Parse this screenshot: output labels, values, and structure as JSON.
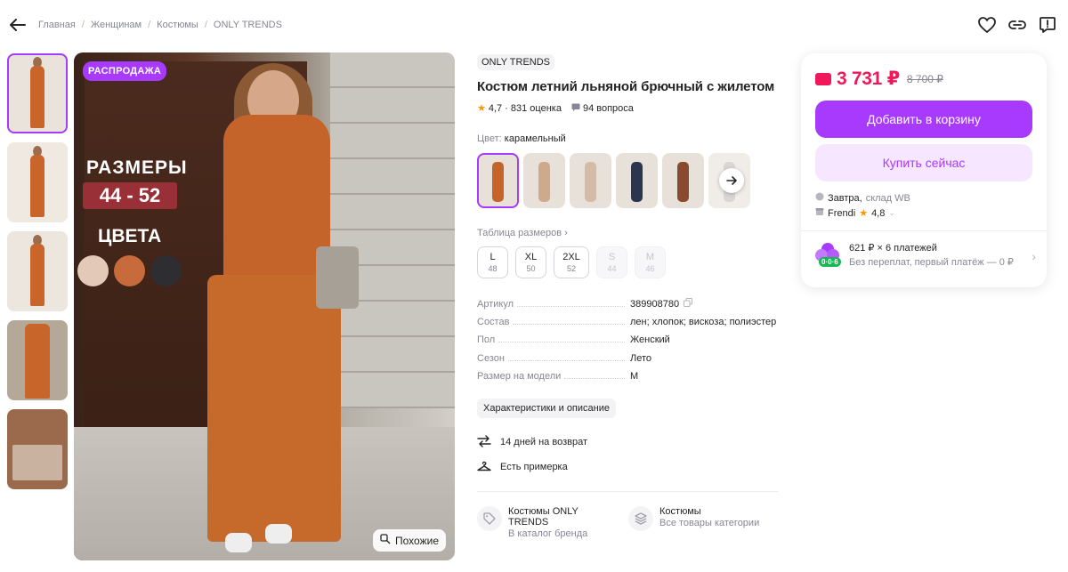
{
  "breadcrumbs": [
    "Главная",
    "Женщинам",
    "Костюмы",
    "ONLY TRENDS"
  ],
  "gallery": {
    "sale_badge": "РАСПРОДАЖА",
    "promo_sizes_title": "РАЗМЕРЫ",
    "promo_size_range": "44 - 52",
    "promo_colors_title": "ЦВЕТА",
    "promo_swatch_colors": [
      "#e2c9b8",
      "#c86b3c",
      "#2e2e32"
    ],
    "similar_label": "Похожие"
  },
  "product": {
    "brand": "ONLY TRENDS",
    "title": "Костюм летний льняной брючный с жилетом",
    "rating": "4,7",
    "rating_count": "· 831 оценка",
    "questions": "94 вопроса",
    "color_label": "Цвет:",
    "color_value": "карамельный",
    "variant_colors": [
      "#c4642a",
      "#cfa98c",
      "#d4bba6",
      "#2c3550",
      "#8a4a2d",
      "#c0bcb8"
    ],
    "size_table_label": "Таблица размеров",
    "sizes": [
      {
        "label": "L",
        "ru": "48",
        "available": true
      },
      {
        "label": "XL",
        "ru": "50",
        "available": true
      },
      {
        "label": "2XL",
        "ru": "52",
        "available": true
      },
      {
        "label": "S",
        "ru": "44",
        "available": false
      },
      {
        "label": "M",
        "ru": "46",
        "available": false
      }
    ],
    "specs": [
      {
        "key": "Артикул",
        "value": "389908780"
      },
      {
        "key": "Состав",
        "value": "лен; хлопок; вискоза; полиэстер"
      },
      {
        "key": "Пол",
        "value": "Женский"
      },
      {
        "key": "Сезон",
        "value": "Лето"
      },
      {
        "key": "Размер на модели",
        "value": "M"
      }
    ],
    "chars_button": "Характеристики и описание",
    "perks": [
      "14 дней на возврат",
      "Есть примерка"
    ],
    "links": [
      {
        "title": "Костюмы ONLY TRENDS",
        "subtitle": "В каталог бренда"
      },
      {
        "title": "Костюмы",
        "subtitle": "Все товары категории"
      }
    ]
  },
  "buy_card": {
    "price": "3 731 ₽",
    "old_price": "8 700 ₽",
    "add_to_cart": "Добавить в корзину",
    "buy_now": "Купить сейчас",
    "delivery": "Завтра,",
    "warehouse": "склад WB",
    "seller": "Frendi",
    "seller_rating": "4,8",
    "installment_title": "621 ₽ × 6 платежей",
    "installment_sub": "Без переплат, первый платёж — 0 ₽",
    "installment_tag": "0·0·6"
  },
  "colors": {
    "accent": "#a73afd",
    "price": "#f0185b",
    "muted": "#868695"
  }
}
